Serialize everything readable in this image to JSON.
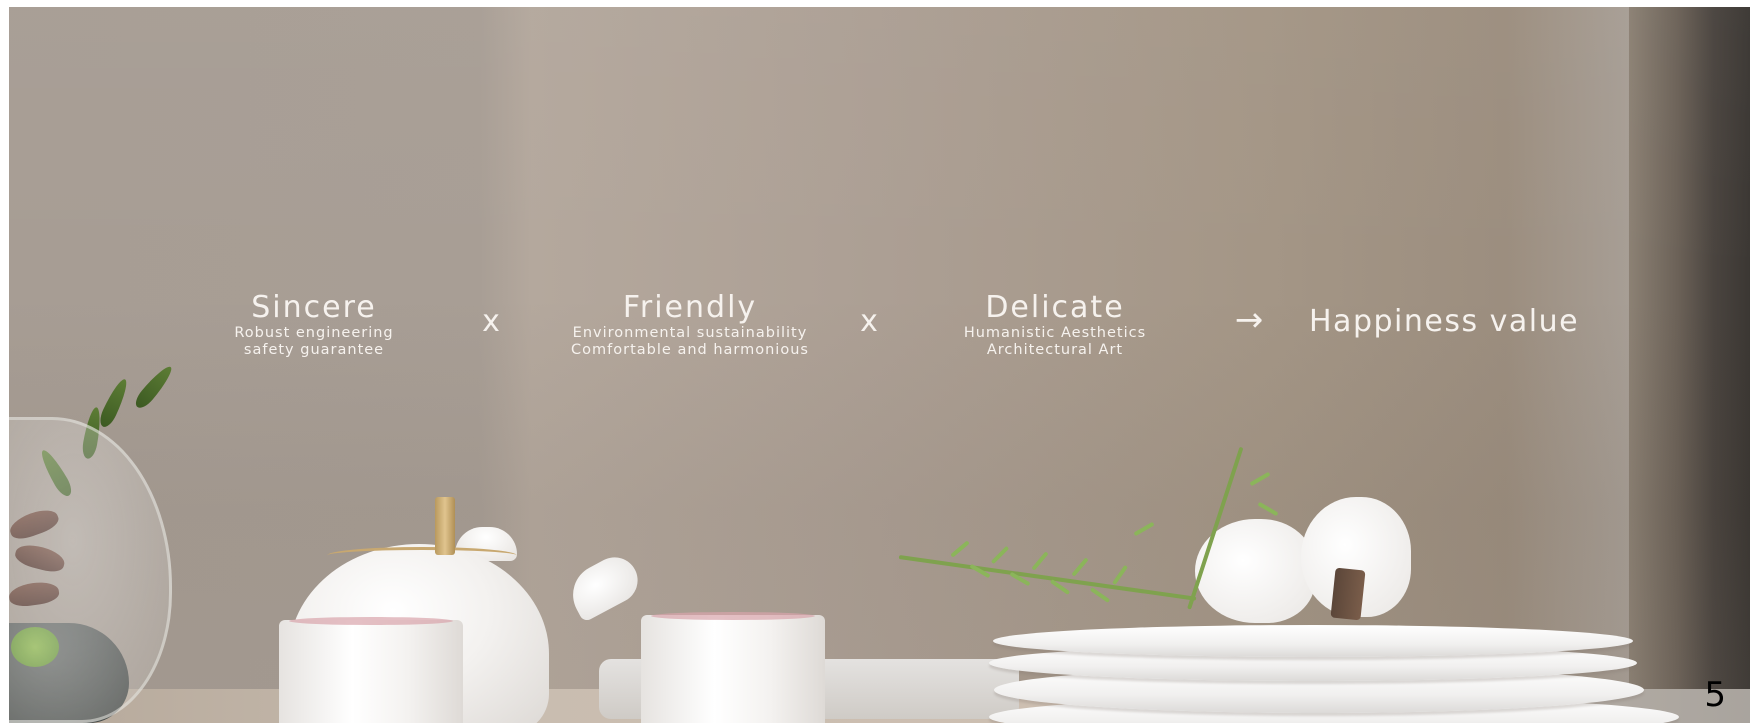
{
  "terms": [
    {
      "title": "Sincere",
      "line1": "Robust engineering",
      "line2": "safety guarantee"
    },
    {
      "title": "Friendly",
      "line1": "Environmental sustainability",
      "line2": "Comfortable and harmonious"
    },
    {
      "title": "Delicate",
      "line1": "Humanistic Aesthetics",
      "line2": "Architectural Art"
    }
  ],
  "operators": {
    "multiply": "x",
    "arrow": "→"
  },
  "result": "Happiness value",
  "page_number": "5",
  "colors": {
    "text": "#f6f2ee",
    "wall": "#ab9e93",
    "page_number": "#000000"
  }
}
